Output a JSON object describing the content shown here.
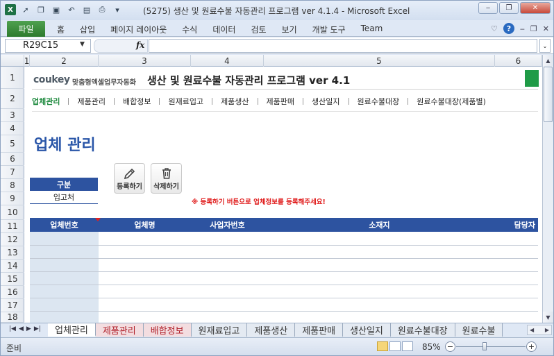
{
  "window": {
    "title": "(5275) 생산 및 원료수불 자동관리 프로그램 ver 4.1.4  -  Microsoft Excel"
  },
  "ribbon": {
    "file_tab": "파일",
    "tabs": [
      "홈",
      "삽입",
      "페이지 레이아웃",
      "수식",
      "데이터",
      "검토",
      "보기",
      "개발 도구",
      "Team"
    ]
  },
  "formula_bar": {
    "name_box": "R29C15",
    "fx_label": "fx",
    "formula": ""
  },
  "columns": [
    "1",
    "2",
    "3",
    "4",
    "5",
    "6"
  ],
  "rows": [
    "1",
    "2",
    "3",
    "4",
    "5",
    "6",
    "7",
    "8",
    "9",
    "10",
    "11",
    "12",
    "13",
    "14",
    "15",
    "16",
    "17",
    "18"
  ],
  "sheet": {
    "logo": "coukey",
    "logo_sub": "맞춤형엑셀업무자동화",
    "app_title": "생산 및 원료수불 자동관리 프로그램 ver 4.1",
    "nav": [
      "업체관리",
      "제품관리",
      "배합정보",
      "원재료입고",
      "제품생산",
      "제품판매",
      "생산일지",
      "원료수불대장",
      "원료수불대장(제품별)"
    ],
    "nav_active": "업체관리",
    "page_title": "업체 관리",
    "gubun_label": "구분",
    "gubun_value": "입고처",
    "register_button": "등록하기",
    "delete_button": "삭제하기",
    "notice": "※ 등록하기 버튼으로 업체정보를 등록해주세요!",
    "table_headers": [
      "업체번호",
      "업체명",
      "사업자번호",
      "소재지",
      "담당자"
    ]
  },
  "sheet_tabs": [
    "업체관리",
    "제품관리",
    "배합정보",
    "원재료입고",
    "제품생산",
    "제품판매",
    "생산일지",
    "원료수불대장",
    "원료수불"
  ],
  "status": {
    "ready": "준비",
    "zoom": "85%"
  },
  "colors": {
    "accent_blue": "#2d53a0",
    "nav_active_green": "#1e8a3e",
    "notice_red": "#e01c1c",
    "title_blue": "#2a56a8"
  }
}
